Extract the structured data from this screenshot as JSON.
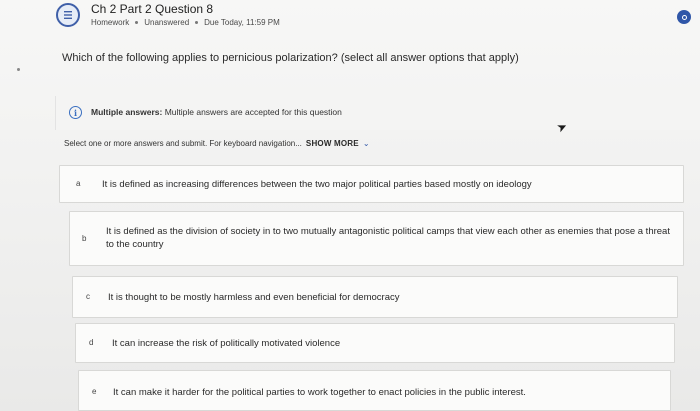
{
  "header": {
    "title": "Ch 2 Part 2 Question 8",
    "meta": [
      "Homework",
      "Unanswered",
      "Due Today, 11:59 PM"
    ]
  },
  "question": {
    "prompt": "Which of the following applies to pernicious polarization? (select all answer options that apply)"
  },
  "notice": {
    "label": "Multiple answers:",
    "text": "Multiple answers are accepted for this question"
  },
  "instructions": {
    "text": "Select one or more answers and submit. For keyboard navigation...",
    "show_more": "SHOW MORE"
  },
  "options": [
    {
      "letter": "a",
      "text": "It is defined as increasing differences between the two major political parties based mostly on ideology"
    },
    {
      "letter": "b",
      "text": "It is defined as the division of society in to two mutually antagonistic political camps that view each other as enemies that pose a threat to the country"
    },
    {
      "letter": "c",
      "text": "It is thought to be mostly harmless and even beneficial for democracy"
    },
    {
      "letter": "d",
      "text": "It can increase the risk of politically motivated violence"
    },
    {
      "letter": "e",
      "text": "It can make it harder for the political parties to work together to enact policies in the public interest."
    }
  ],
  "colors": {
    "accent": "#2f56a8",
    "info": "#3a6fc0"
  },
  "icons": [
    "app-list-icon",
    "info-icon",
    "chevron-down-icon",
    "status-circle-icon",
    "mouse-cursor-icon"
  ]
}
